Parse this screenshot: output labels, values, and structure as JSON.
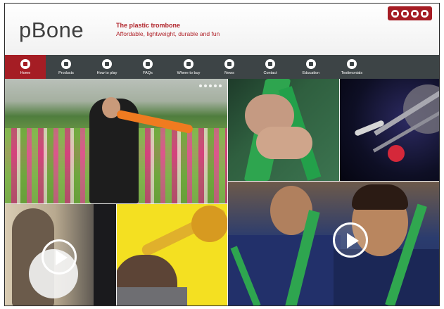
{
  "header": {
    "logo": "pBone",
    "tagline_title": "The plastic trombone",
    "tagline_sub": "Affordable, lightweight, durable and fun",
    "social_icons": [
      "facebook-icon",
      "twitter-icon",
      "email-icon",
      "youtube-icon"
    ]
  },
  "nav": {
    "items": [
      {
        "label": "Home",
        "icon": "home-icon",
        "active": true
      },
      {
        "label": "Products",
        "icon": "products-icon"
      },
      {
        "label": "How to play",
        "icon": "how-to-play-icon"
      },
      {
        "label": "FAQs",
        "icon": "faq-icon"
      },
      {
        "label": "Where to buy",
        "icon": "location-icon"
      },
      {
        "label": "News",
        "icon": "news-icon"
      },
      {
        "label": "Contact",
        "icon": "phone-icon"
      },
      {
        "label": "Education",
        "icon": "education-icon"
      },
      {
        "label": "Testimonials",
        "icon": "testimonials-icon"
      }
    ]
  },
  "colors": {
    "brand_red": "#a51d24",
    "nav_bg": "#3d4446",
    "trombone_green": "#2ea54f"
  }
}
